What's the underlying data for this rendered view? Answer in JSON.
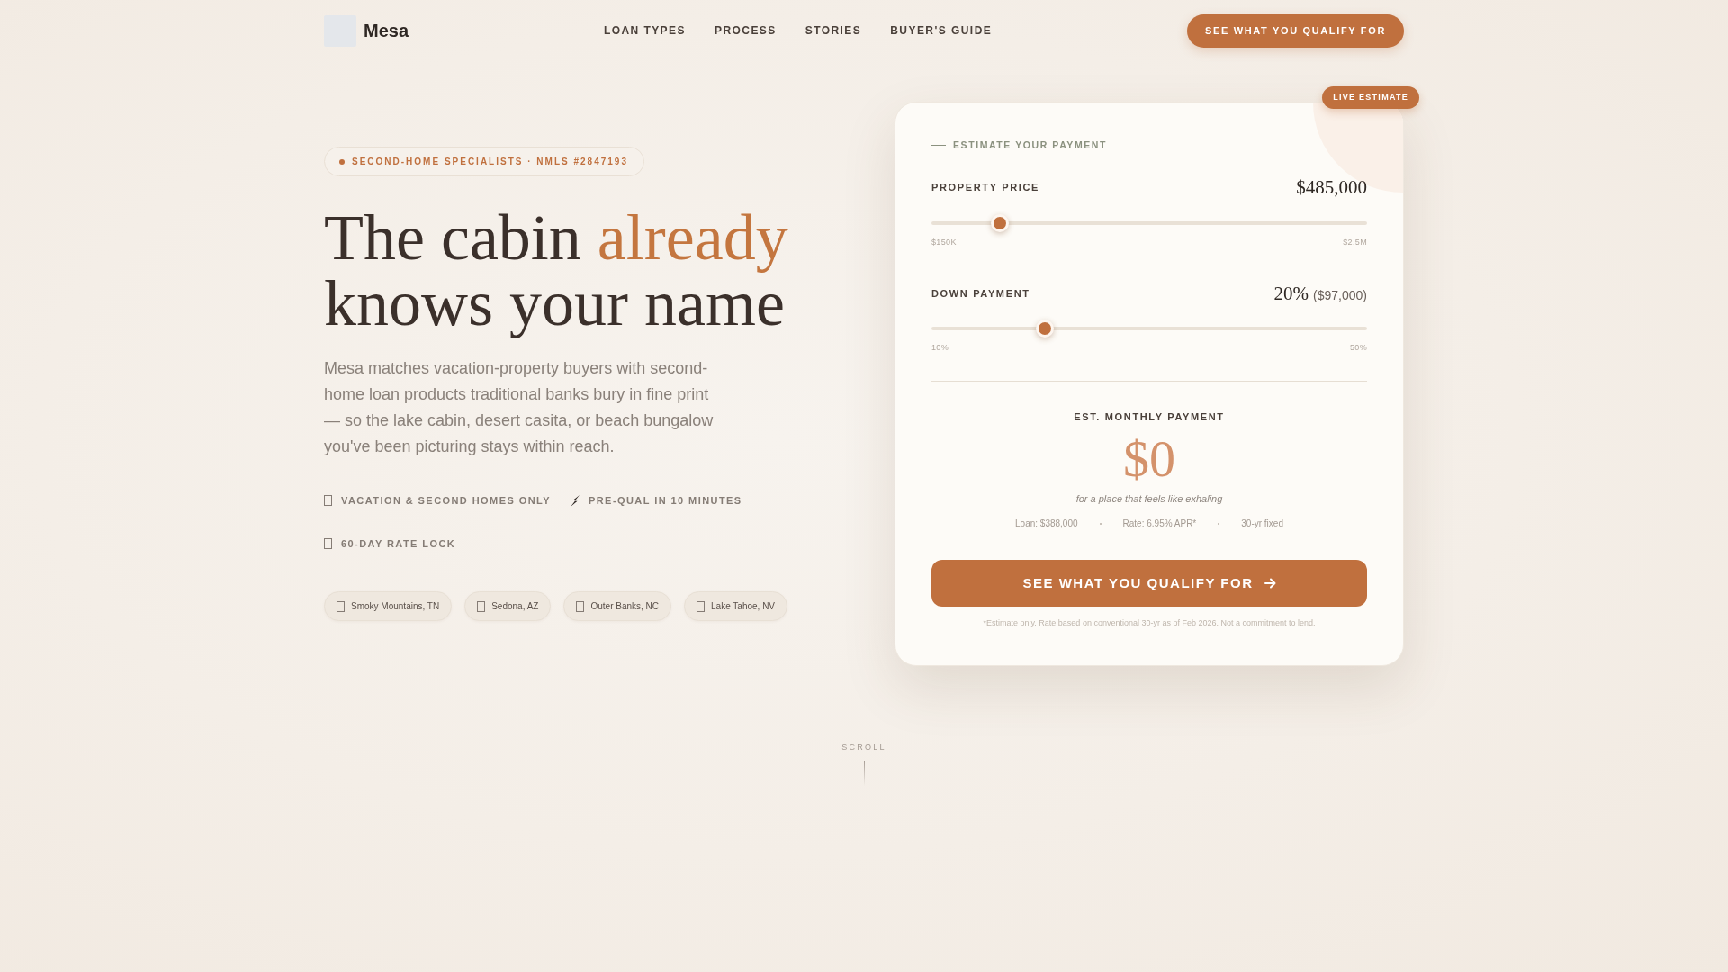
{
  "header": {
    "logo": "Mesa",
    "nav": [
      {
        "label": "LOAN TYPES"
      },
      {
        "label": "PROCESS"
      },
      {
        "label": "STORIES"
      },
      {
        "label": "BUYER'S GUIDE"
      }
    ],
    "cta": "SEE WHAT YOU QUALIFY FOR"
  },
  "hero": {
    "badge": "SECOND-HOME SPECIALISTS · NMLS #2847193",
    "headline": [
      {
        "text": "The cabin ",
        "highlighted": false
      },
      {
        "text": "already",
        "highlighted": true
      },
      {
        "text": " knows your name",
        "highlighted": false
      }
    ],
    "description": "Mesa matches vacation-property buyers with second-home loan products traditional banks bury in fine print — so the lake cabin, desert casita, or beach bungalow you've been picturing stays within reach.",
    "features": [
      {
        "kind": "glyph",
        "label": "VACATION & SECOND HOMES ONLY"
      },
      {
        "kind": "bolt",
        "label": "PRE-QUAL IN 10 MINUTES"
      },
      {
        "kind": "glyph",
        "label": "60-DAY RATE LOCK"
      }
    ],
    "locations": [
      "Smoky Mountains, TN",
      "Sedona, AZ",
      "Outer Banks, NC",
      "Lake Tahoe, NV"
    ]
  },
  "estimator": {
    "badge": "LIVE ESTIMATE",
    "eyebrow": "ESTIMATE YOUR PAYMENT",
    "sliders": [
      {
        "label": "PROPERTY PRICE",
        "value": "$485,000",
        "level": 0.143,
        "min_label": "$150K",
        "max_label": "$2.5M"
      },
      {
        "label": "DOWN PAYMENT",
        "value": "20%",
        "value_note": "($97,000)",
        "level": 0.25,
        "min_label": "10%",
        "max_label": "50%"
      }
    ],
    "result": {
      "label": "EST. MONTHLY PAYMENT",
      "amount": "$0",
      "caption": "for a place that feels like exhaling",
      "details": [
        "Loan: $388,000",
        "Rate: 6.95% APR*",
        "30-yr fixed"
      ]
    },
    "button": "SEE WHAT YOU QUALIFY FOR",
    "disclaimer": "*Estimate only. Rate based on conventional 30-yr as of Feb 2026. Not a commitment to lend."
  },
  "scroll_hint": "SCROLL"
}
